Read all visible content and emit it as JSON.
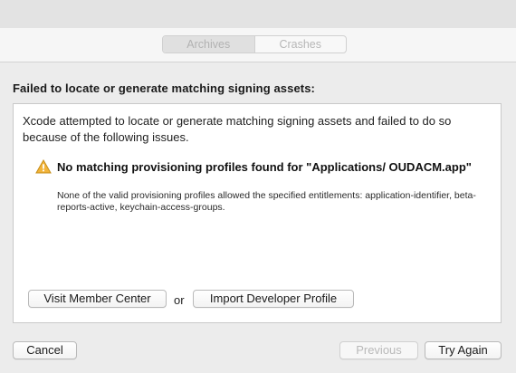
{
  "tabs": {
    "archives": "Archives",
    "crashes": "Crashes"
  },
  "dialog": {
    "title": "Failed to locate or generate matching signing assets:",
    "intro": "Xcode attempted to locate or generate matching signing assets and failed to do so because of the following issues.",
    "issue": {
      "icon": "warning-icon",
      "title": "No matching provisioning profiles found for \"Applications/ OUDACM.app\"",
      "detail": "None of the valid provisioning profiles allowed the specified entitlements: application-identifier, beta-reports-active, keychain-access-groups."
    },
    "actions": {
      "visit_member_center": "Visit Member Center",
      "or": "or",
      "import_developer_profile": "Import Developer Profile"
    }
  },
  "footer": {
    "cancel": "Cancel",
    "previous": "Previous",
    "try_again": "Try Again"
  },
  "colors": {
    "warning": "#f2b43a",
    "panel": "#ffffff",
    "window_bg": "#ececec"
  }
}
